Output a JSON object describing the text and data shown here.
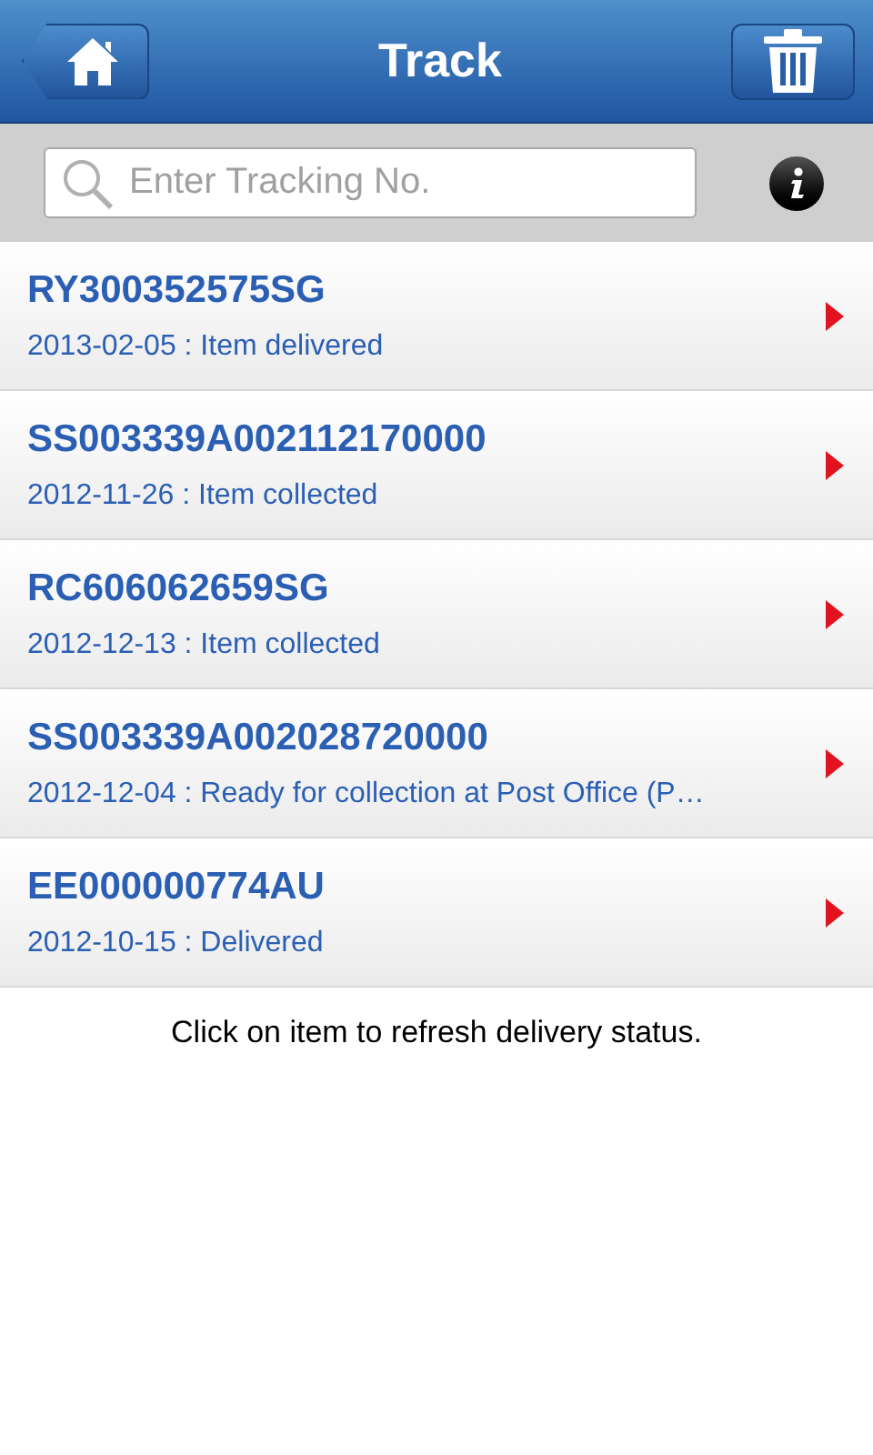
{
  "header": {
    "title": "Track"
  },
  "search": {
    "placeholder": "Enter Tracking No."
  },
  "items": [
    {
      "number": "RY300352575SG",
      "status": "2013-02-05 : Item delivered"
    },
    {
      "number": "SS003339A002112170000",
      "status": "2012-11-26 : Item collected"
    },
    {
      "number": "RC606062659SG",
      "status": "2012-12-13 : Item collected"
    },
    {
      "number": "SS003339A002028720000",
      "status": "2012-12-04 : Ready for collection at Post Office (P…"
    },
    {
      "number": "EE000000774AU",
      "status": "2012-10-15 : Delivered"
    }
  ],
  "hint": "Click on item to refresh delivery status."
}
